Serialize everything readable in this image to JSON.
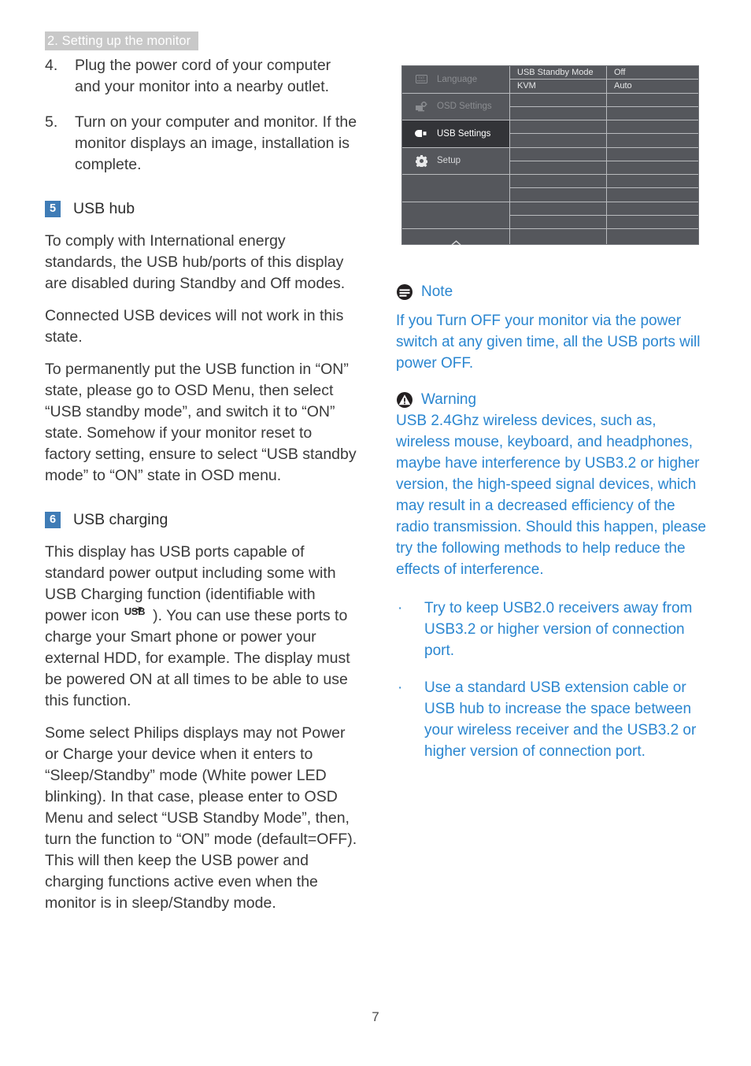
{
  "header": {
    "chapter": "2. Setting up the monitor"
  },
  "left_column": {
    "steps": [
      {
        "number": "4.",
        "text": "Plug the power cord of your computer and your monitor into a nearby outlet."
      },
      {
        "number": "5.",
        "text": "Turn on your computer and monitor. If the monitor displays an image, installation is complete."
      }
    ],
    "usb_hub": {
      "badge": "5",
      "title": "USB hub",
      "paragraphs": [
        "To comply with International energy standards, the USB hub/ports of this display are disabled during Standby and Off modes.",
        "Connected USB devices will not work in this state.",
        "To permanently put the USB function in “ON” state, please go to OSD Menu, then select “USB standby mode”, and switch it to “ON” state. Somehow if your monitor reset to factory setting, ensure to select “USB standby mode” to “ON” state in OSD menu."
      ]
    },
    "usb_charging": {
      "badge": "6",
      "title": "USB charging",
      "paragraph_1_before_icon": "This display has USB ports capable of standard power output including some with USB Charging function (identifiable with power icon ",
      "power_icon_label": "USB",
      "power_icon_name": "usb-power-icon",
      "paragraph_1_after_icon": " ). You can use these ports to charge your Smart phone or power your external HDD, for example.  The display must be powered ON at all times to be able to use this function.",
      "paragraph_2": "Some select Philips displays may not Power or Charge your device when it enters to “Sleep/Standby” mode (White power LED blinking). In that case, please enter to OSD Menu and select “USB Standby Mode”, then, turn the function to “ON” mode (default=OFF). This will then keep the USB power and charging functions active even when the monitor is in sleep/Standby mode."
    }
  },
  "osd_menu": {
    "sidebar": [
      {
        "label": "Language",
        "icon": "language-icon",
        "state": "dim"
      },
      {
        "label": "OSD Settings",
        "icon": "osd-settings-icon",
        "state": "dim"
      },
      {
        "label": "USB Settings",
        "icon": "usb-plug-icon",
        "state": "active"
      },
      {
        "label": "Setup",
        "icon": "gear-icon",
        "state": "normal"
      }
    ],
    "sidebar_blank_rows": 2,
    "scroll_indicator": "chevron-up-icon",
    "settings": [
      {
        "name": "USB Standby Mode",
        "value": "Off"
      },
      {
        "name": "KVM",
        "value": "Auto"
      }
    ],
    "empty_setting_rows": 10,
    "colors": {
      "background": "#55575c",
      "active_row": "#333438",
      "divider": "#b9bbbe",
      "text": "#d9dadc",
      "dim_text": "#8b8d91"
    }
  },
  "right_column": {
    "note": {
      "icon": "note-icon",
      "title": "Note",
      "body": "If you Turn OFF your monitor via the power switch at any given time, all the USB ports will power OFF."
    },
    "warning": {
      "icon": "warning-icon",
      "title": "Warning",
      "body": "USB 2.4Ghz wireless devices, such as, wireless mouse, keyboard, and headphones, maybe have interference by USB3.2 or higher version, the high-speed signal devices, which may result in a decreased efficiency of the radio transmission.  Should this happen, please try the following methods to help reduce the effects of interference."
    },
    "bullets": [
      {
        "marker": "·",
        "text": "Try to keep USB2.0 receivers away from USB3.2 or higher version of connection port."
      },
      {
        "marker": "·",
        "text": "Use a standard USB extension cable or USB hub to increase the space between your wireless receiver and the USB3.2 or higher version of connection port."
      }
    ],
    "accent_color": "#2a86d0"
  },
  "footer": {
    "page_number": "7"
  }
}
